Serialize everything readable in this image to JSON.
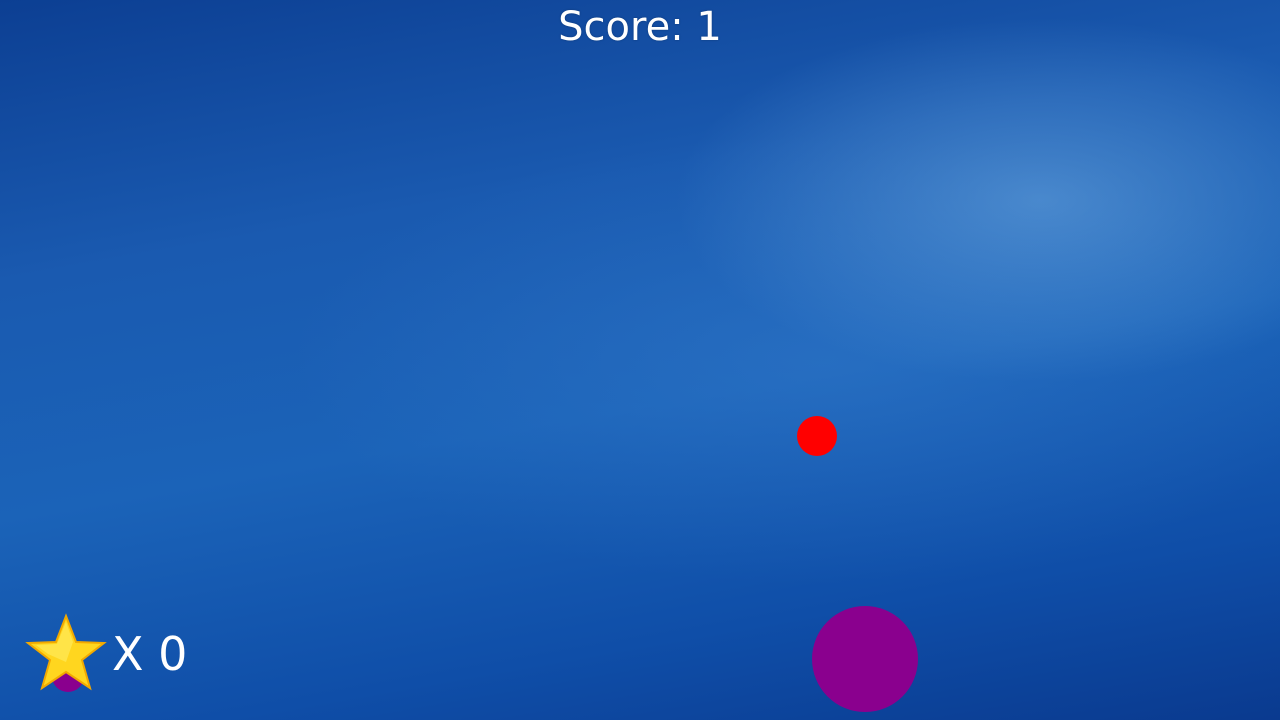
{
  "hud": {
    "score_text": "Score: 1",
    "stars_text": "X 0"
  },
  "colors": {
    "ball": "#ff0000",
    "player": "#8a008e",
    "star_fill": "#ffd61f",
    "text": "#ffffff"
  },
  "icons": {
    "star": "star-icon"
  }
}
